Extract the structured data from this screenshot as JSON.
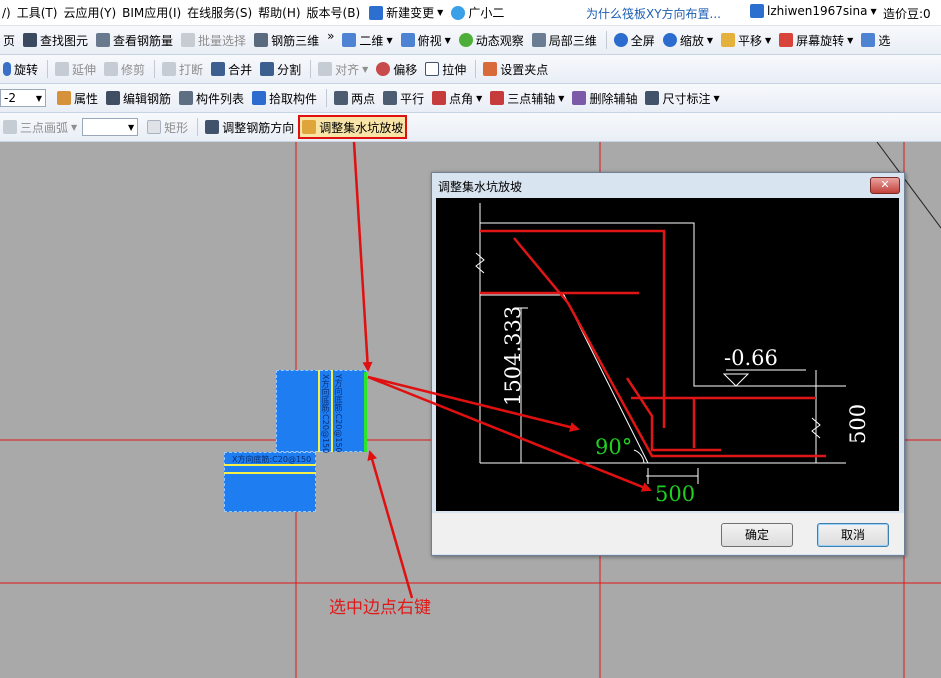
{
  "menubar": {
    "items": [
      "/)",
      "工具(T)",
      "云应用(Y)",
      "BIM应用(I)",
      "在线服务(S)",
      "帮助(H)",
      "版本号(B)"
    ],
    "new_change": "新建变更",
    "assistant": "广小二",
    "question": "为什么筏板XY方向布置...",
    "user": "lzhiwen1967sina",
    "beans": "造价豆:0"
  },
  "toolbar1": {
    "items": [
      "页",
      "查找图元",
      "查看钢筋量",
      "批量选择",
      "钢筋三维",
      "二维",
      "俯视",
      "动态观察",
      "局部三维",
      "全屏",
      "缩放",
      "平移",
      "屏幕旋转",
      "选"
    ]
  },
  "toolbar2": {
    "items": [
      "旋转",
      "延伸",
      "修剪",
      "打断",
      "合并",
      "分割",
      "对齐",
      "偏移",
      "拉伸",
      "设置夹点"
    ]
  },
  "toolbar3": {
    "combo_value": "-2",
    "items": [
      "属性",
      "编辑钢筋",
      "构件列表",
      "拾取构件",
      "两点",
      "平行",
      "点角",
      "三点辅轴",
      "删除辅轴",
      "尺寸标注"
    ]
  },
  "toolbar4": {
    "items": [
      "三点画弧",
      "矩形",
      "调整钢筋方向",
      "调整集水坑放坡"
    ]
  },
  "dialog": {
    "title": "调整集水坑放坡",
    "close": "✕",
    "dim_height": "1504.333",
    "elevation": "-0.66",
    "depth": "500",
    "angle": "90°",
    "width": "500",
    "ok": "确定",
    "cancel": "取消"
  },
  "canvas": {
    "label_a": "X方向底筋:C20@150",
    "label_b": "Y方向底筋:C20@150",
    "label_c": "X方向底筋:C20@150",
    "caption": "选中边点右键"
  },
  "colors": {
    "accent": "#e01010",
    "block": "#1e7df0",
    "dim_green": "#1fd11f"
  }
}
